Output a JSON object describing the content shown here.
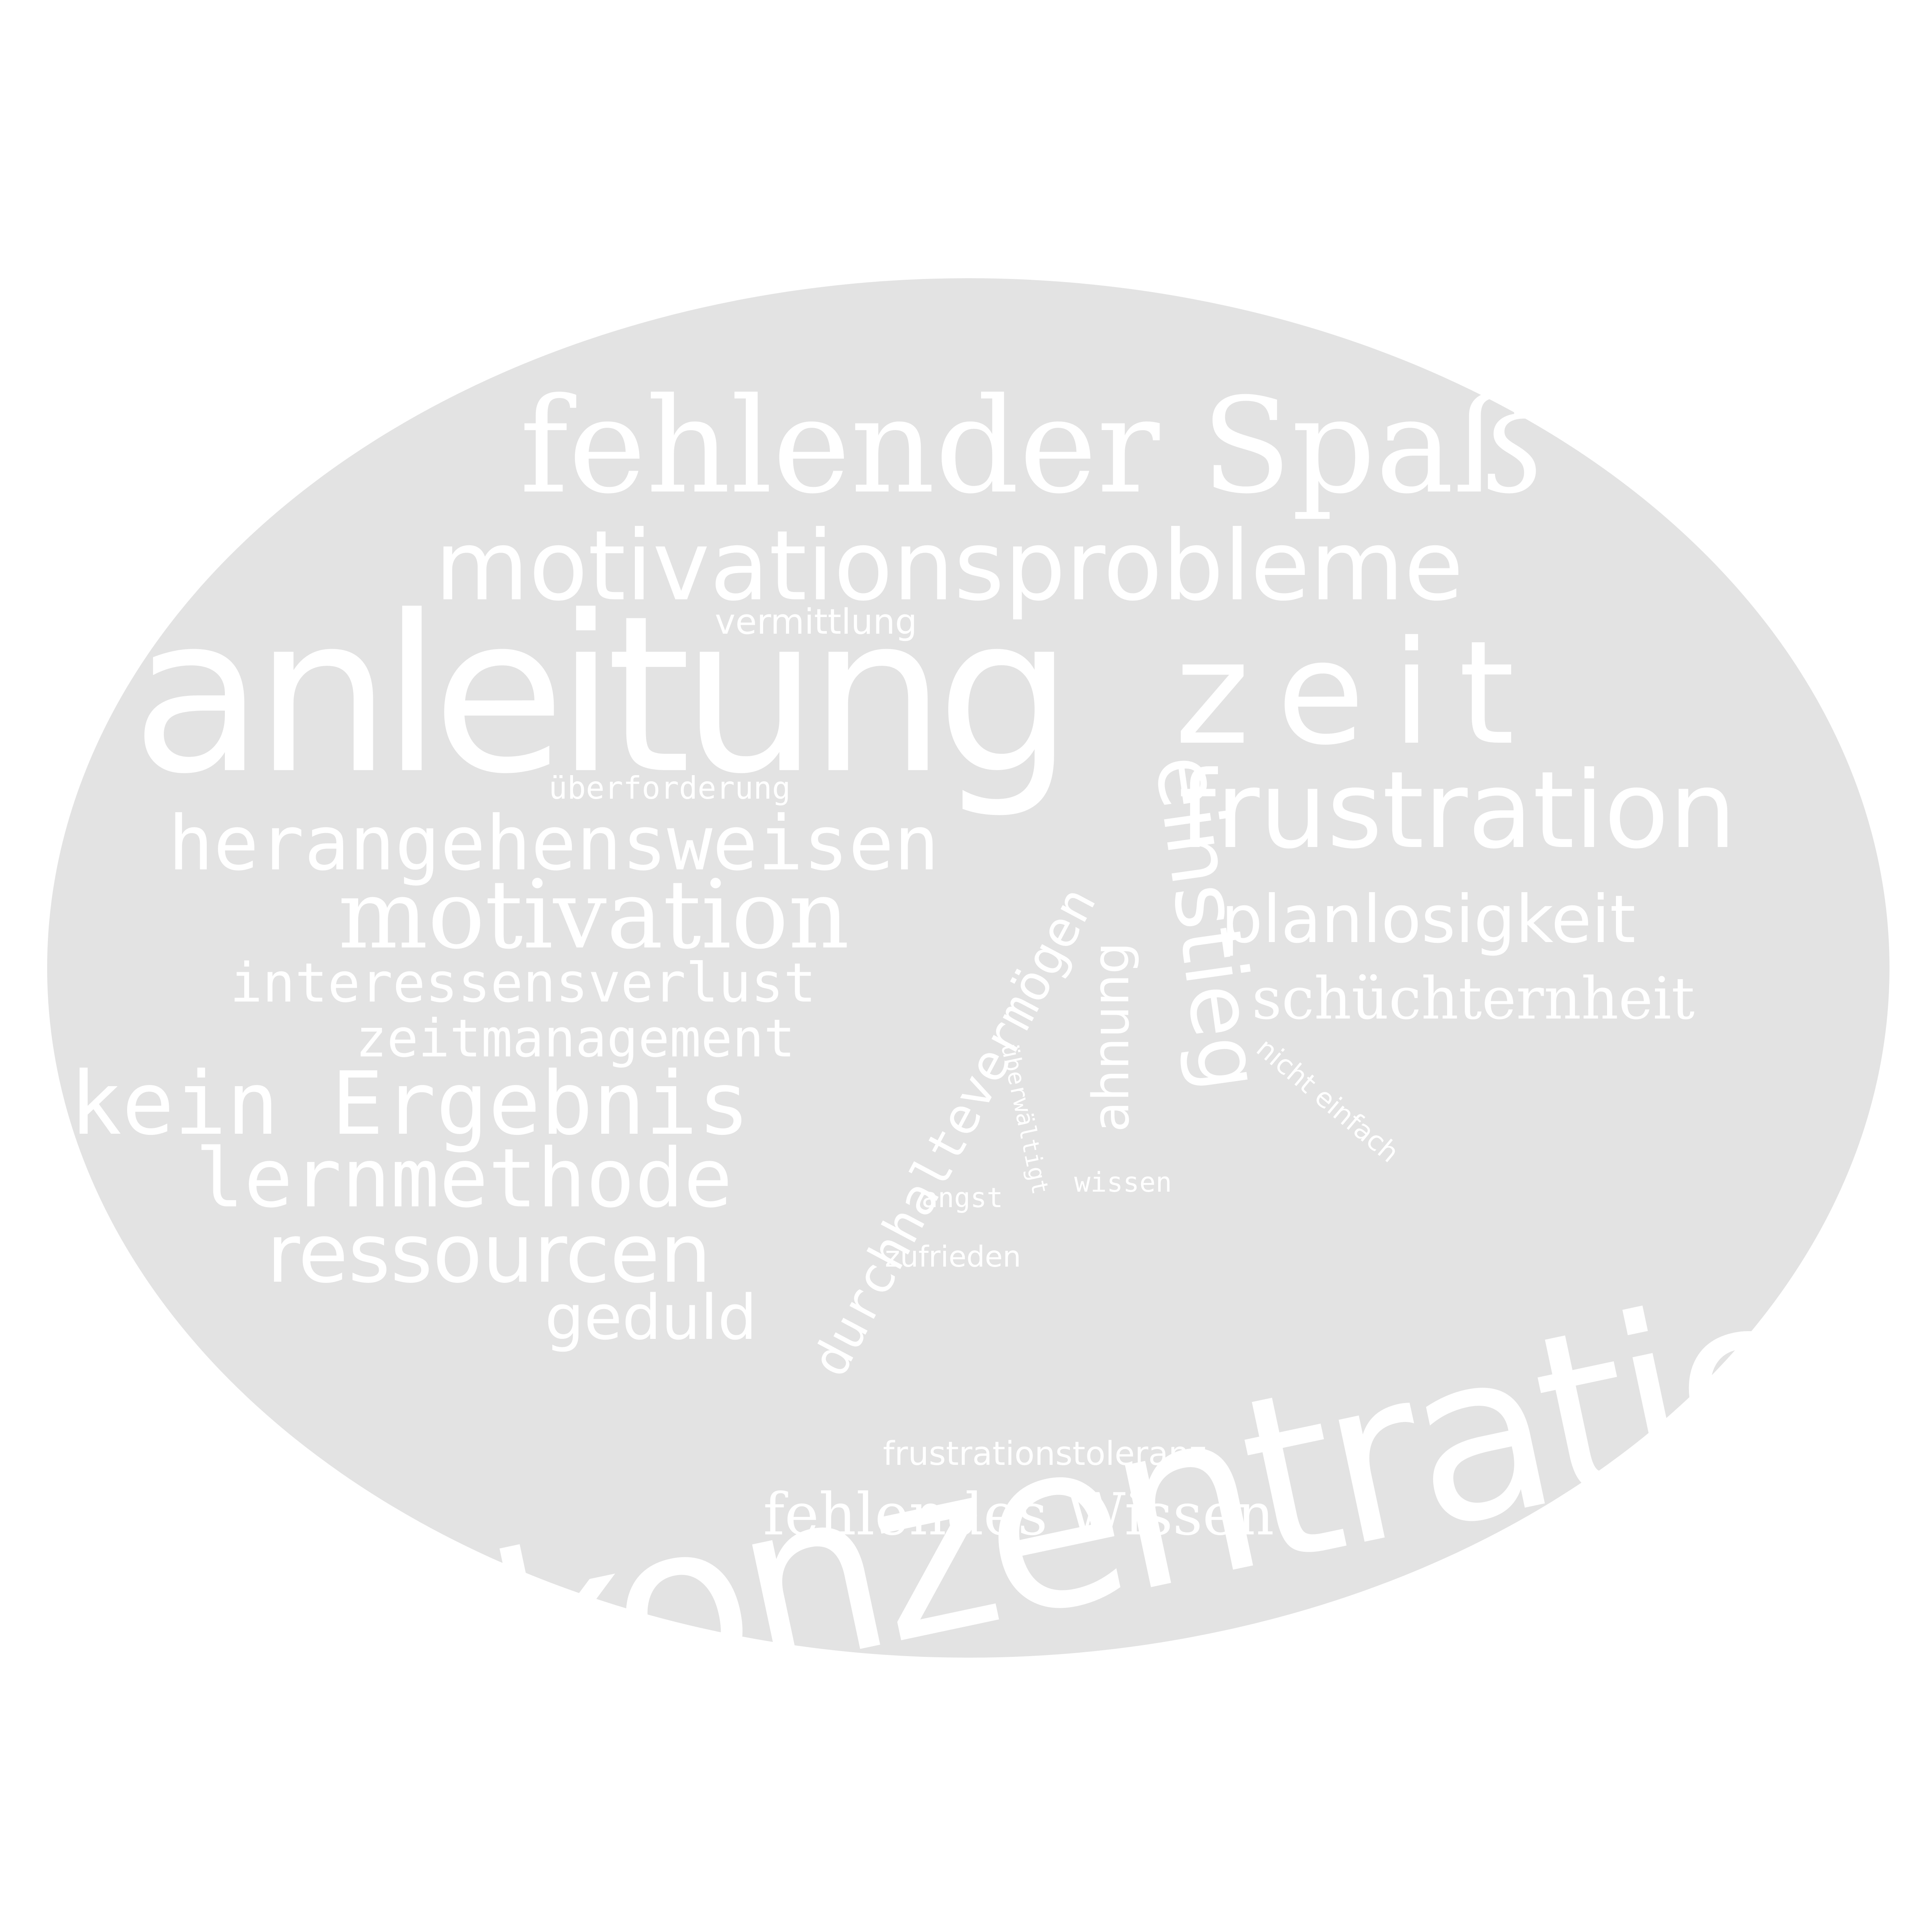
{
  "background_color": "#ffffff",
  "shape_color": "#e3e3e3",
  "word_color": "#ffffff",
  "words": {
    "fehlender_spass": "fehlender Spaß",
    "motivationsprobleme": "motivationsprobleme",
    "vermittlung": "vermittlung",
    "anleitung": "anleitung",
    "zeit": "zeit",
    "ueberforderung": "überforderung",
    "frustration": "frustration",
    "herangehensweisen": "herangehensweisen",
    "motivation": "motivation",
    "planlosigkeit": "planlosigkeit",
    "interessensverlust": "interessensverlust",
    "schuechternheit": "schüchternheit",
    "zeitmanagement": "zeitmanagement",
    "kein_ergebnis": "kein Ergebnis",
    "lernmethode": "lernmethode",
    "ressourcen": "ressourcen",
    "geduld": "geduld",
    "durchhaltevermoegen": "durchhaltevermögen",
    "einstieg": "einstieg",
    "ahnung": "ahnung",
    "ueberwaeltigt": "überwältigt",
    "nicht_einfach": "nicht einfach",
    "angst": "angst",
    "wissen": "wissen",
    "zufrieden": "zufrieden",
    "konzentration": "konzentration",
    "frustrationstoleranz": "frustrationstoleranz",
    "fehlendes_wissen": "fehlendes Wissen"
  }
}
